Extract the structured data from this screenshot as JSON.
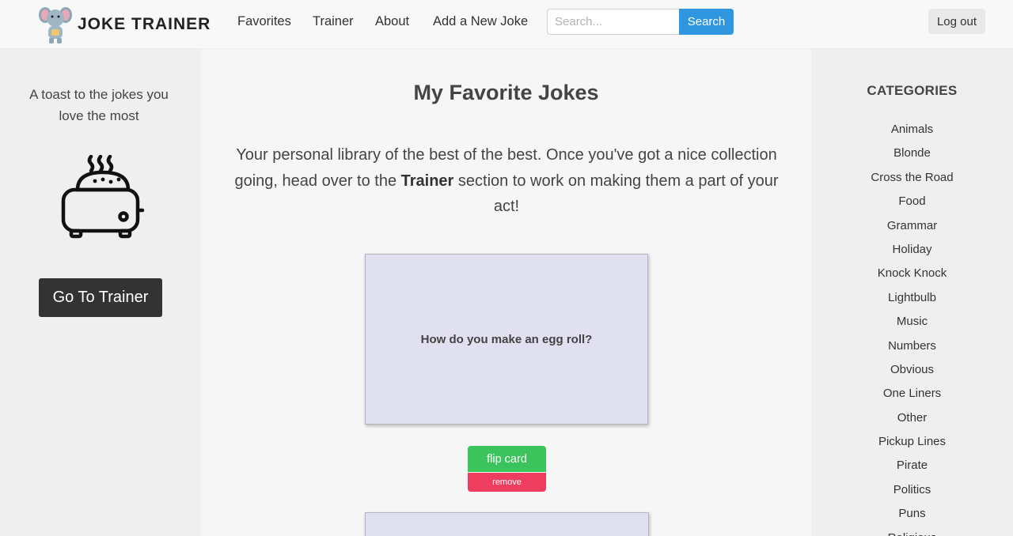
{
  "app": {
    "brand": "JOKE TRAINER"
  },
  "nav": {
    "links": [
      "Favorites",
      "Trainer",
      "About",
      "Add a New Joke"
    ],
    "search_placeholder": "Search...",
    "search_button": "Search",
    "logout": "Log out"
  },
  "left_sidebar": {
    "tagline": "A toast to the jokes you love the most",
    "trainer_button": "Go To Trainer",
    "icon": "toaster-icon"
  },
  "main": {
    "title": "My Favorite Jokes",
    "intro_before": "Your personal library of the best of the best. Once you've got a nice collection going, head over to the ",
    "intro_bold": "Trainer",
    "intro_after": " section to work on making them a part of your act!",
    "cards": [
      {
        "question": "How do you make an egg roll?",
        "flip_label": "flip card",
        "remove_label": "remove"
      }
    ]
  },
  "categories": {
    "heading": "CATEGORIES",
    "items": [
      "Animals",
      "Blonde",
      "Cross the Road",
      "Food",
      "Grammar",
      "Holiday",
      "Knock Knock",
      "Lightbulb",
      "Music",
      "Numbers",
      "Obvious",
      "One Liners",
      "Other",
      "Pickup Lines",
      "Pirate",
      "Politics",
      "Puns",
      "Religious"
    ]
  },
  "colors": {
    "search_button": "#2e97e0",
    "flip_button": "#3cc45c",
    "remove_button": "#ee3d5f",
    "trainer_button": "#333333",
    "card_background": "#e0e0f0"
  }
}
